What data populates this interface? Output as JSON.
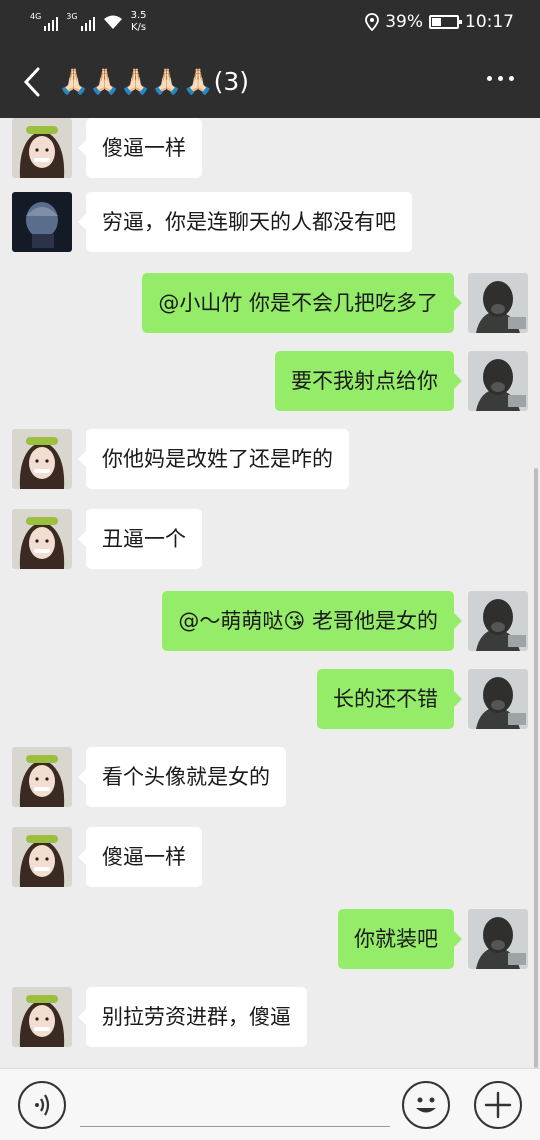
{
  "status_bar": {
    "network_1": "4G",
    "network_2": "3G",
    "speed_value": "3.5",
    "speed_unit": "K/s",
    "battery": "39%",
    "battery_level": 0.39,
    "time": "10:17"
  },
  "header": {
    "title": "🙏🏻🙏🏻🙏🏻🙏🏻🙏🏻(3)"
  },
  "messages": [
    {
      "side": "left",
      "avatar": "girl-avatar",
      "text": "傻逼一样"
    },
    {
      "side": "left",
      "avatar": "dark-avatar",
      "text": "穷逼，你是连聊天的人都没有吧"
    },
    {
      "side": "right",
      "avatar": "statue-avatar",
      "text": "@小山竹  你是不会几把吃多了"
    },
    {
      "side": "right",
      "avatar": "statue-avatar",
      "text": "要不我射点给你"
    },
    {
      "side": "left",
      "avatar": "girl-avatar",
      "text": "你他妈是改姓了还是咋的"
    },
    {
      "side": "left",
      "avatar": "girl-avatar",
      "text": "丑逼一个"
    },
    {
      "side": "right",
      "avatar": "statue-avatar",
      "text": "@～萌萌哒😘  老哥他是女的"
    },
    {
      "side": "right",
      "avatar": "statue-avatar",
      "text": "长的还不错"
    },
    {
      "side": "left",
      "avatar": "girl-avatar",
      "text": "看个头像就是女的"
    },
    {
      "side": "left",
      "avatar": "girl-avatar",
      "text": "傻逼一样"
    },
    {
      "side": "right",
      "avatar": "statue-avatar",
      "text": "你就装吧"
    },
    {
      "side": "left",
      "avatar": "girl-avatar",
      "text": "别拉劳资进群，傻逼"
    }
  ],
  "input_bar": {
    "voice_icon": "voice-icon",
    "emoji_icon": "emoji-icon",
    "plus_icon": "plus-icon"
  }
}
